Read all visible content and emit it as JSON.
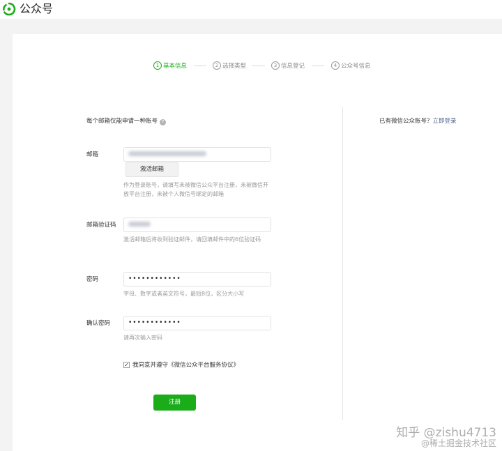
{
  "header": {
    "app_title": "公众号"
  },
  "steps": [
    {
      "num": "1",
      "label": "基本信息",
      "active": true
    },
    {
      "num": "2",
      "label": "选择类型",
      "active": false
    },
    {
      "num": "3",
      "label": "信息登记",
      "active": false
    },
    {
      "num": "4",
      "label": "公众号信息",
      "active": false
    }
  ],
  "form": {
    "notice": "每个邮箱仅能申请一种账号",
    "help_icon": "?",
    "email": {
      "label": "邮箱",
      "activate_button": "激活邮箱",
      "hint": "作为登录账号，请填写未被微信公众平台注册，未被微信开放平台注册，未被个人微信号绑定的邮箱"
    },
    "code": {
      "label": "邮箱验证码",
      "hint": "激活邮箱后将收到验证邮件，请回填邮件中的6位验证码"
    },
    "password": {
      "label": "密码",
      "value": "••••••••••••",
      "hint": "字母、数字或者英文符号，最短8位，区分大小写"
    },
    "confirm": {
      "label": "确认密码",
      "value": "••••••••••••",
      "hint": "请再次输入密码"
    },
    "agreement_prefix": "我同意并遵守",
    "agreement_link": "《微信公众平台服务协议》",
    "checkbox_mark": "✓",
    "register_button": "注册"
  },
  "side": {
    "prompt": "已有微信公众账号？",
    "login_link": "立即登录"
  },
  "watermark": {
    "line1": "知乎 @zishu4713",
    "line2": "@稀土掘金技术社区"
  },
  "colors": {
    "accent": "#1aad19",
    "link": "#576b95"
  }
}
